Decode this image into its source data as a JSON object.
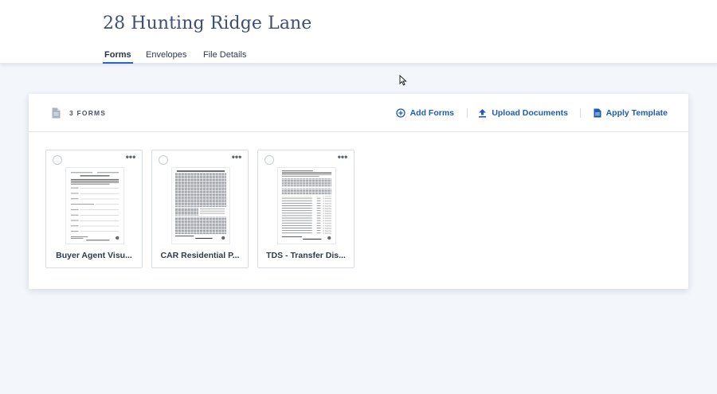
{
  "header": {
    "title": "28 Hunting Ridge Lane",
    "tabs": [
      {
        "label": "Forms",
        "active": true
      },
      {
        "label": "Envelopes",
        "active": false
      },
      {
        "label": "File Details",
        "active": false
      }
    ]
  },
  "panel": {
    "count_label": "3 FORMS",
    "count_icon": "document-icon",
    "actions": [
      {
        "label": "Add Forms",
        "icon": "plus-circle-icon"
      },
      {
        "label": "Upload Documents",
        "icon": "upload-icon"
      },
      {
        "label": "Apply Template",
        "icon": "document-icon"
      }
    ],
    "forms": [
      {
        "name": "Buyer Agent Visu..."
      },
      {
        "name": "CAR Residential P..."
      },
      {
        "name": "TDS - Transfer Dis..."
      }
    ]
  },
  "colors": {
    "accent": "#2464c4",
    "link": "#1f5bb8",
    "title": "#3d4f73",
    "background": "#f3f6fb"
  }
}
